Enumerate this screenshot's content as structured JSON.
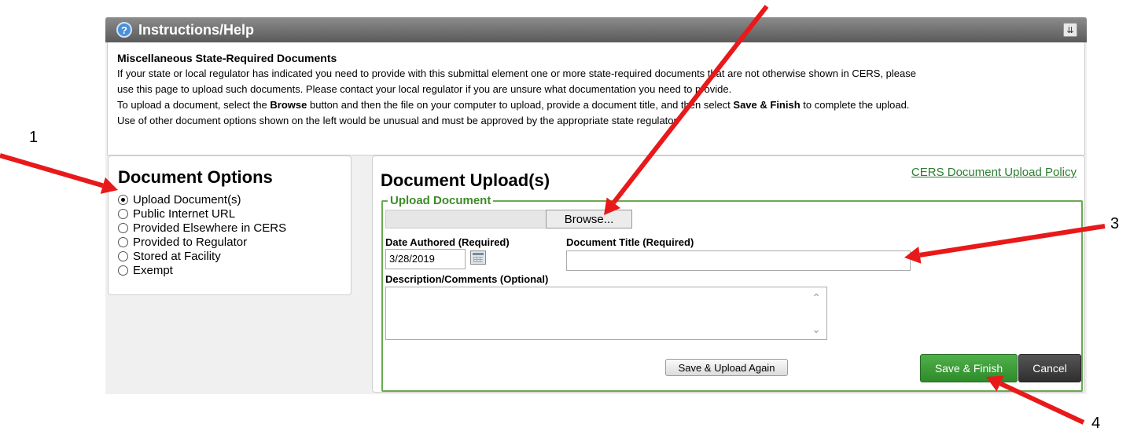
{
  "help": {
    "title": "Instructions/Help",
    "heading": "Miscellaneous State-Required Documents",
    "line1": "If your state or local regulator has indicated you need to provide with this submittal element one or more state-required documents that are not otherwise shown in CERS, please",
    "line2": "use this page to upload such documents. Please contact your local regulator if you are unsure what documentation you need to provide.",
    "line3_a": "To upload a document, select the ",
    "line3_b": "Browse",
    "line3_c": " button and then the file on your computer to upload, provide a document title, and then select ",
    "line3_d": "Save & Finish",
    "line3_e": " to complete the upload.",
    "line4": "Use of other document options shown on the left would be unusual and must be approved by the appropriate state regulator."
  },
  "options": {
    "title": "Document Options",
    "items": [
      {
        "label": "Upload Document(s)",
        "checked": true
      },
      {
        "label": "Public Internet URL",
        "checked": false
      },
      {
        "label": "Provided Elsewhere in CERS",
        "checked": false
      },
      {
        "label": "Provided to Regulator",
        "checked": false
      },
      {
        "label": "Stored at Facility",
        "checked": false
      },
      {
        "label": "Exempt",
        "checked": false
      }
    ]
  },
  "upload": {
    "title": "Document Upload(s)",
    "policy_link": "CERS Document Upload Policy",
    "legend": "Upload Document",
    "browse_label": "Browse...",
    "date_label": "Date Authored (Required)",
    "date_value": "3/28/2019",
    "doc_title_label": "Document Title (Required)",
    "doc_title_value": "",
    "desc_label": "Description/Comments (Optional)",
    "desc_value": "",
    "upload_again_label": "Save & Upload Again",
    "save_finish_label": "Save & Finish",
    "cancel_label": "Cancel"
  },
  "callouts": [
    "1",
    "3",
    "4"
  ],
  "colors": {
    "arrow": "#e8191a",
    "accent_green": "#2e8b2a",
    "header_gray": "#6e6e6e"
  }
}
